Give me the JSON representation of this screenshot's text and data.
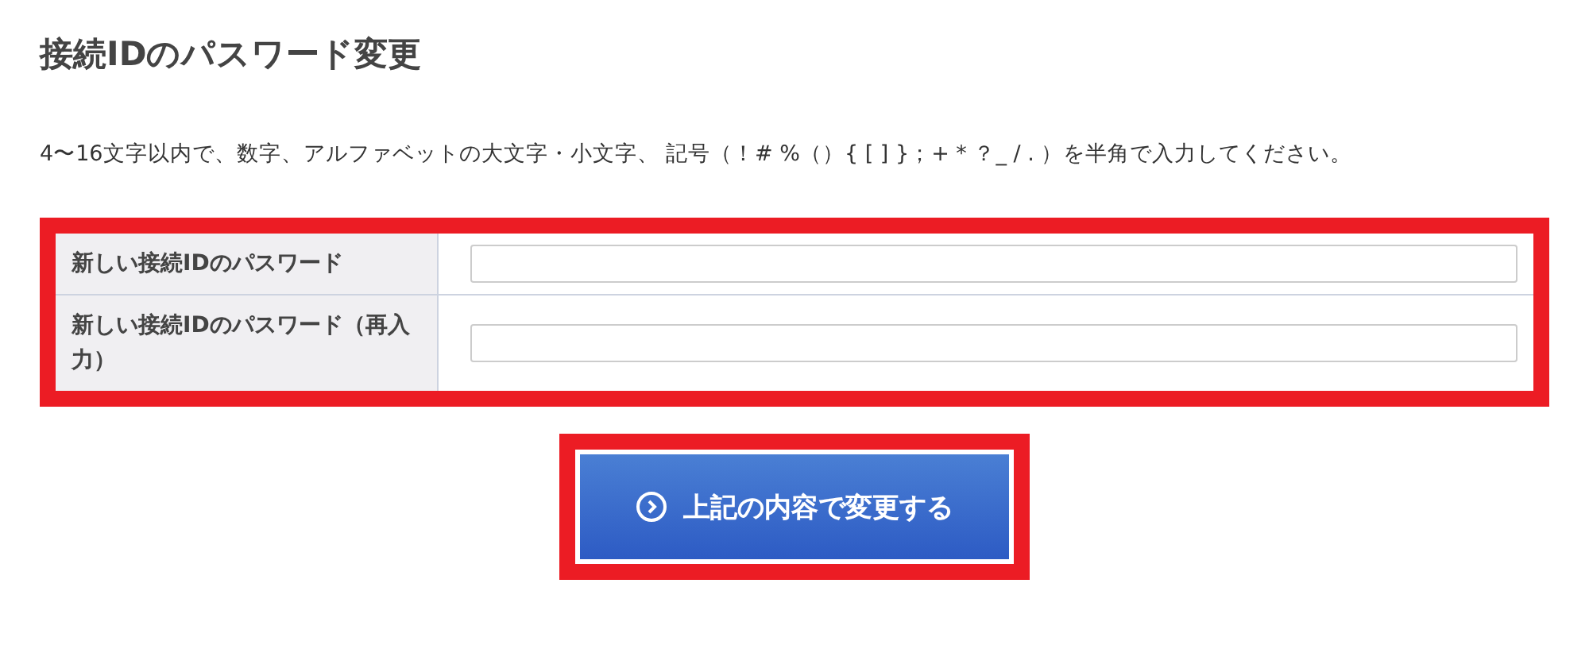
{
  "title": "接続IDのパスワード変更",
  "description": "4〜16文字以内で、数字、アルファベットの大文字・小文字、 記号（！# %（）{ [ ] }；+ * ？_ / . ）を半角で入力してください。",
  "fields": [
    {
      "label": "新しい接続IDのパスワード"
    },
    {
      "label": "新しい接続IDのパスワード（再入力）"
    }
  ],
  "submit_button": {
    "label": "上記の内容で変更する"
  }
}
